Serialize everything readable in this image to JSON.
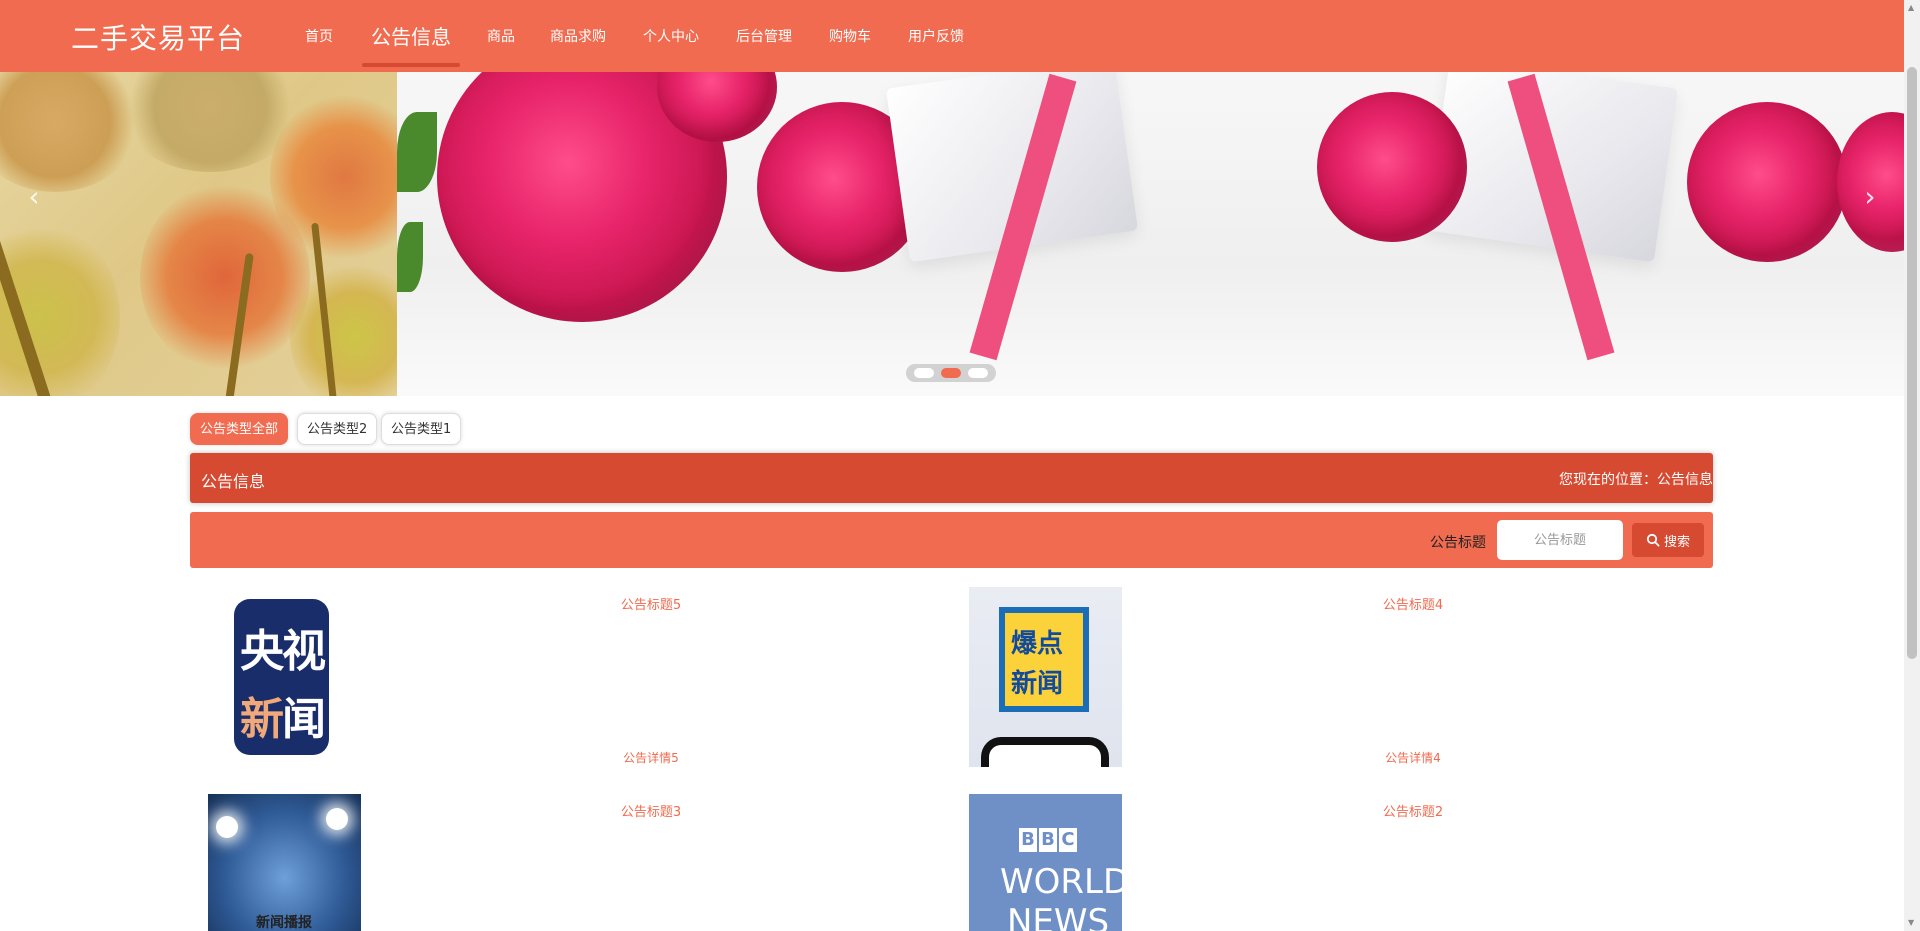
{
  "header": {
    "brand": "二手交易平台",
    "nav": [
      {
        "label": "首页"
      },
      {
        "label": "公告信息",
        "active": true
      },
      {
        "label": "商品"
      },
      {
        "label": "商品求购"
      },
      {
        "label": "个人中心"
      },
      {
        "label": "后台管理"
      },
      {
        "label": "购物车"
      },
      {
        "label": "用户反馈"
      }
    ]
  },
  "carousel": {
    "prev_icon": "chevron-left-icon",
    "next_icon": "chevron-right-icon",
    "dots": 3,
    "active_dot": 2
  },
  "filters": {
    "types": [
      "公告类型全部",
      "公告类型2",
      "公告类型1"
    ],
    "active": "公告类型全部"
  },
  "titlebar": {
    "title": "公告信息",
    "location": "您现在的位置：公告信息"
  },
  "search": {
    "label": "公告标题",
    "placeholder": "公告标题",
    "button": "搜索",
    "button_icon": "search-icon"
  },
  "announcements": [
    {
      "title": "公告标题5",
      "detail": "公告详情5",
      "image": "央视新闻"
    },
    {
      "title": "公告标题4",
      "detail": "公告详情4",
      "image": "爆点新闻"
    },
    {
      "title": "公告标题3",
      "detail": "",
      "image": "新闻播报"
    },
    {
      "title": "公告标题2",
      "detail": "",
      "image": "BBC WORLD NEWS"
    }
  ],
  "colors": {
    "primary": "#f06b4f",
    "dark": "#d54a31",
    "white": "#ffffff"
  }
}
